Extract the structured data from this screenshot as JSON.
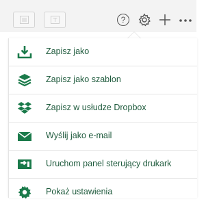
{
  "toolbar": {
    "help_icon": "help-icon",
    "help_glyph": "?",
    "settings_icon": "gear-icon",
    "add_icon": "plus-icon",
    "more_icon": "more-icon"
  },
  "menu": {
    "items": [
      {
        "label": "Zapisz jako",
        "icon": "download-icon"
      },
      {
        "label": "Zapisz jako szablon",
        "icon": "layers-icon"
      },
      {
        "label": "Zapisz w usłudze Dropbox",
        "icon": "dropbox-icon"
      },
      {
        "label": "Wyślij jako e-mail",
        "icon": "envelope-icon"
      },
      {
        "label": "Uruchom panel sterujący drukark",
        "icon": "printer-panel-icon"
      },
      {
        "label": "Pokaż ustawienia",
        "icon": "settings-icon"
      }
    ]
  },
  "colors": {
    "icon_green": "#1a7a4a",
    "label_color": "#1e5a3c",
    "toolbar_bg": "#f3f3f3"
  }
}
